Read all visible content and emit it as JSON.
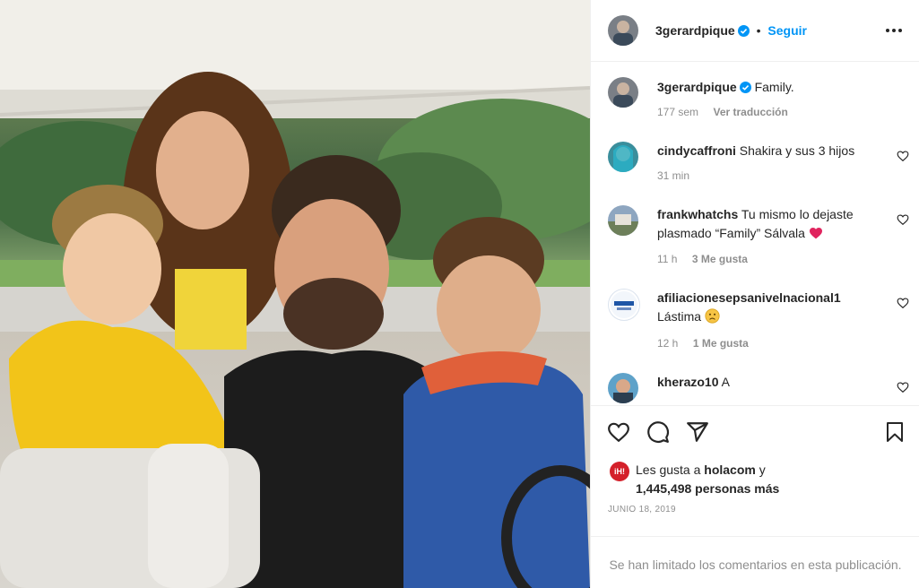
{
  "header": {
    "username": "3gerardpique",
    "separator": "•",
    "follow_label": "Seguir",
    "more_icon": "more-horizontal-icon"
  },
  "caption": {
    "username": "3gerardpique",
    "text": "Family.",
    "time": "177 sem",
    "translate_label": "Ver traducción"
  },
  "comments": [
    {
      "username": "cindycaffroni",
      "text": "Shakira y sus 3 hijos",
      "time": "31 min",
      "likes": ""
    },
    {
      "username": "frankwhatchs",
      "text": "Tu mismo lo dejaste",
      "text2": "plasmado “Family” Sálvala",
      "time": "11 h",
      "likes": "3 Me gusta",
      "emoji": "heart"
    },
    {
      "username": "afiliacionesepsanivelnacional1",
      "text": "Lástima",
      "emoji": "sad-face",
      "time": "12 h",
      "likes": "1 Me gusta"
    },
    {
      "username": "kherazo10",
      "text": "A",
      "time": "",
      "likes": ""
    }
  ],
  "actions": {
    "like_icon": "heart-icon",
    "comment_icon": "comment-icon",
    "share_icon": "send-icon",
    "save_icon": "bookmark-icon"
  },
  "likes": {
    "badge": "iH!",
    "prefix": "Les gusta a",
    "user": "holacom",
    "conjunction": "y",
    "count_text": "1,445,498 personas más"
  },
  "date": "JUNIO 18, 2019",
  "comments_limited": "Se han limitado los comentarios en esta publicación.",
  "colors": {
    "verified_blue": "#0095f6",
    "follow_blue": "#0095f6",
    "heart_red": "#e0245e",
    "muted": "#8e8e8e"
  }
}
